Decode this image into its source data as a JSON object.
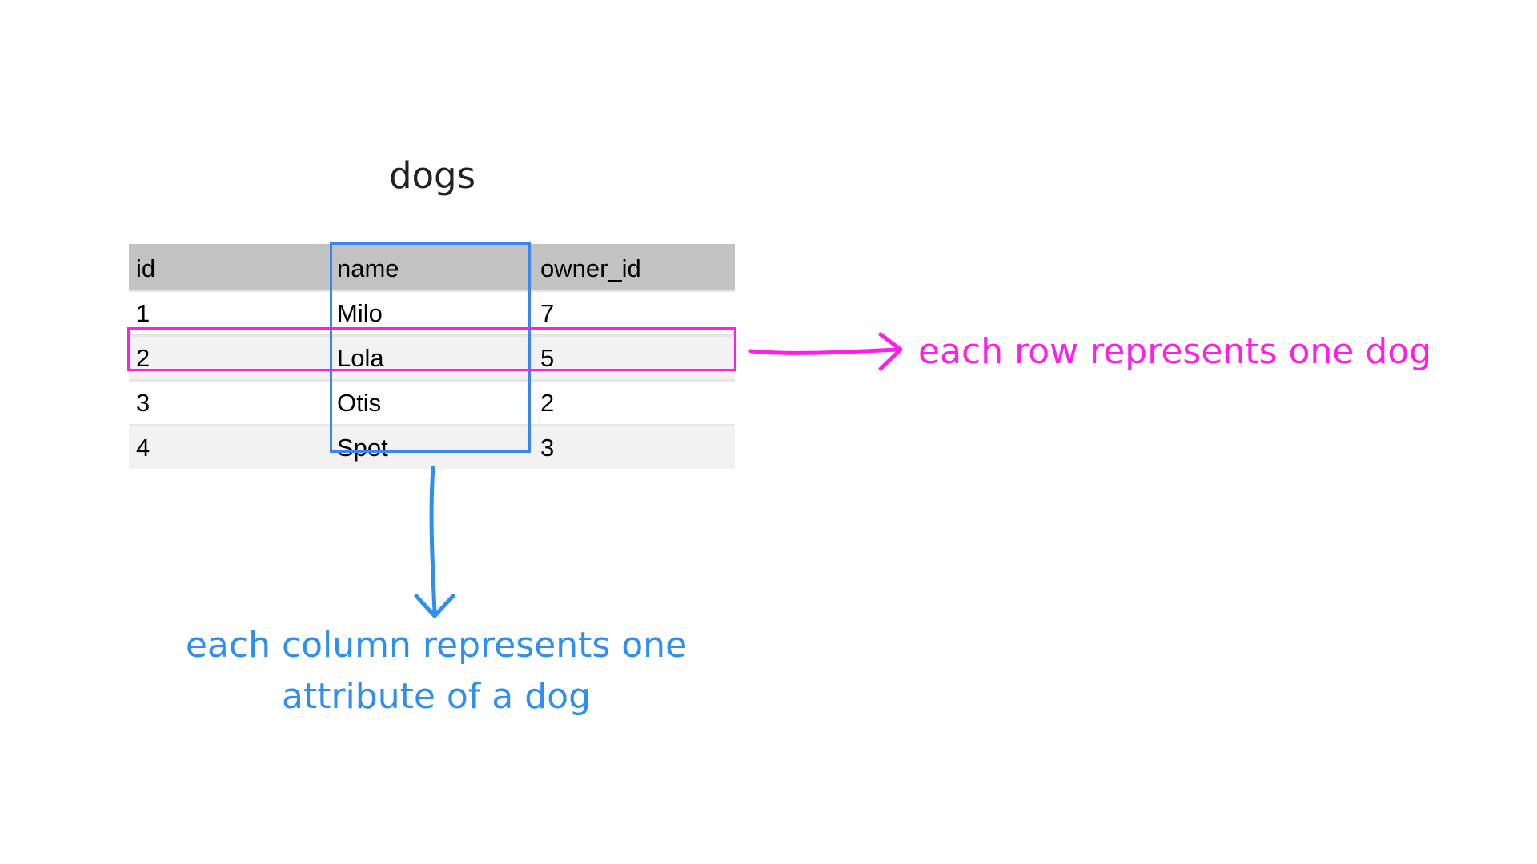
{
  "diagram": {
    "title": "dogs",
    "table": {
      "headers": [
        "id",
        "name",
        "owner_id"
      ],
      "rows": [
        [
          "1",
          "Milo",
          "7"
        ],
        [
          "2",
          "Lola",
          "5"
        ],
        [
          "3",
          "Otis",
          "2"
        ],
        [
          "4",
          "Spot",
          "3"
        ]
      ]
    },
    "row_annotation": "each row represents one dog",
    "column_annotation_line1": "each column represents one",
    "column_annotation_line2": "attribute of a dog",
    "colors": {
      "row_highlight": "#ff1ee6",
      "column_highlight": "#3a86ee",
      "header_background": "#c2c2c2"
    }
  }
}
